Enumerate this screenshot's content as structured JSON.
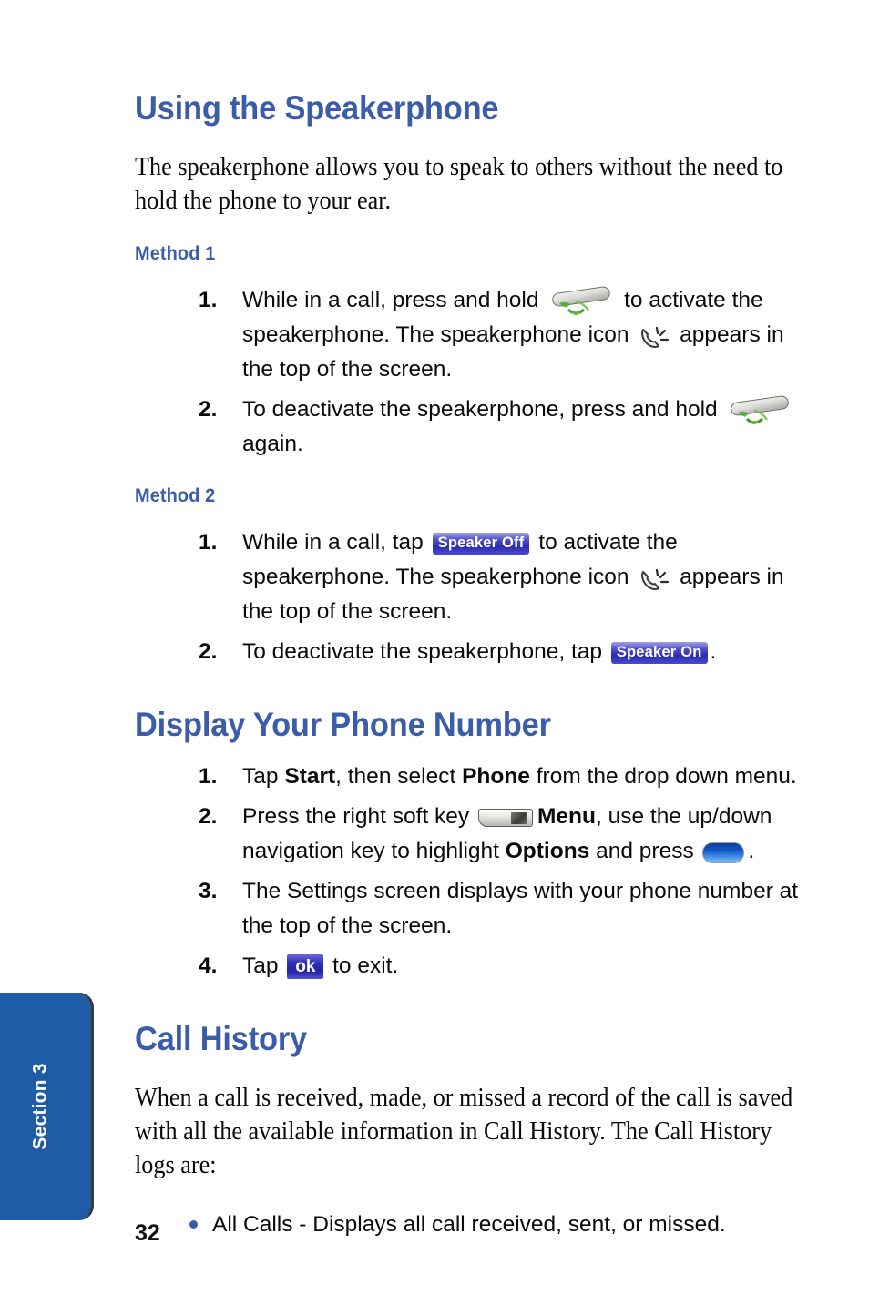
{
  "page": {
    "number": "32",
    "side_tab_label": "Section 3",
    "tab_color": "#1f5ca8",
    "heading_color": "#3b5ca8",
    "bullet_color": "#3b5ca8"
  },
  "sections": [
    {
      "heading": "Using the Speakerphone",
      "intro": "The speakerphone allows you to speak to others without the need to hold the phone to your ear.",
      "methods": [
        {
          "label": "Method 1",
          "steps": [
            {
              "number": "1.",
              "parts": [
                "While in a call, press and hold ",
                " to activate the speakerphone. The speakerphone icon ",
                " appears in the top of the screen."
              ],
              "icons": [
                "send-key",
                "speakerphone-icon"
              ]
            },
            {
              "number": "2.",
              "parts": [
                "To deactivate the speakerphone, press and hold ",
                " again."
              ],
              "icons": [
                "send-key"
              ]
            }
          ]
        },
        {
          "label": "Method 2",
          "steps": [
            {
              "number": "1.",
              "parts": [
                "While in a call, tap ",
                " to activate the speakerphone. The speakerphone icon ",
                " appears in the top of the screen."
              ],
              "icons": [
                "speaker-off-badge",
                "speakerphone-icon"
              ]
            },
            {
              "number": "2.",
              "parts": [
                "To deactivate the speakerphone, tap ",
                "."
              ],
              "icons": [
                "speaker-on-badge"
              ]
            }
          ]
        }
      ]
    },
    {
      "heading": "Display Your Phone Number",
      "steps": [
        {
          "number": "1.",
          "text_a": "Tap ",
          "bold_a": "Start",
          "text_b": ", then select ",
          "bold_b": "Phone",
          "text_c": " from the drop down menu."
        },
        {
          "number": "2.",
          "text_a": "Press the right soft key ",
          "bold_a": "Menu",
          "text_b": ", use the up/down navigation key to highlight ",
          "bold_b": "Options",
          "text_c": " and press ",
          "text_d": "."
        },
        {
          "number": "3.",
          "text_a": "The Settings screen displays with your phone number at the top of the screen."
        },
        {
          "number": "4.",
          "text_a": "Tap ",
          "text_b": " to exit."
        }
      ]
    },
    {
      "heading": "Call History",
      "intro": "When a call is received, made, or missed a record of the call is saved with all the available information in Call History. The Call History logs are:",
      "bullets": [
        "All Calls - Displays all call received, sent, or missed."
      ]
    }
  ],
  "badges": {
    "speaker_off": "Speaker Off",
    "speaker_on": "Speaker On",
    "ok": "ok"
  }
}
